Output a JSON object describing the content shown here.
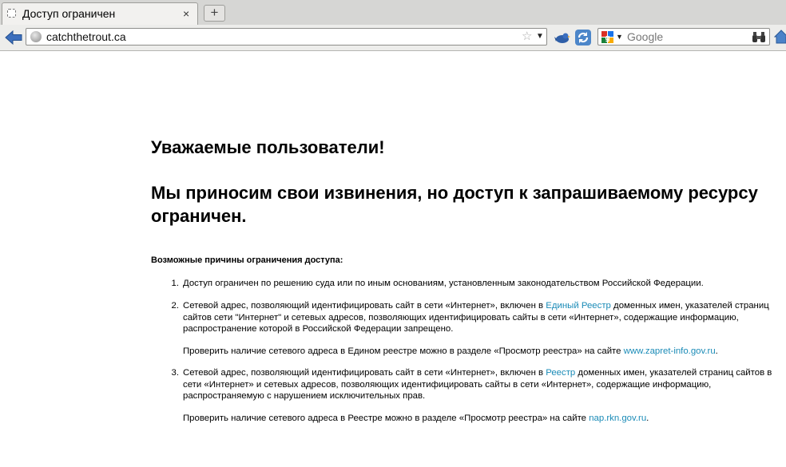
{
  "browser": {
    "tab": {
      "title": "Доступ ограничен",
      "close": "×"
    },
    "new_tab": "+",
    "url": "catchthetrout.ca",
    "search": {
      "engine": "Google",
      "placeholder": "Google"
    }
  },
  "page": {
    "greeting": "Уважаемые пользователи!",
    "apology": "Мы приносим свои извинения, но доступ к запрашиваемому ресурсу ограничен.",
    "reasons_title": "Возможные причины ограничения доступа:",
    "reasons": [
      {
        "num": "1.",
        "text": "Доступ ограничен  по решению суда или по иным основаниям, установленным законодательством Российской Федерации."
      },
      {
        "num": "2.",
        "text_before": "Сетевой адрес, позволяющий идентифицировать сайт в сети «Интернет», включен в ",
        "link": "Единый Реестр",
        "text_after": " доменных имен, указателей страниц сайтов сети \"Интернет\" и сетевых адресов, позволяющих идентифицировать сайты в сети «Интернет», содержащие информацию, распространение которой в Российской Федерации запрещено.",
        "check_before": "Проверить наличие сетевого адреса в Едином реестре можно в разделе «Просмотр реестра» на сайте ",
        "check_link": "www.zapret-info.gov.ru",
        "check_after": "."
      },
      {
        "num": "3.",
        "text_before": "Сетевой адрес, позволяющий идентифицировать сайт в сети «Интернет», включен в ",
        "link": "Реестр",
        "text_after": " доменных имен, указателей страниц сайтов в сети «Интернет» и сетевых адресов, позволяющих идентифицировать сайты в сети «Интернет», содержащие информацию, распространяемую с нарушением исключительных прав.",
        "check_before": "Проверить наличие сетевого адреса в Реестре можно в разделе «Просмотр реестра» на сайте ",
        "check_link": "nap.rkn.gov.ru",
        "check_after": "."
      }
    ]
  },
  "colors": {
    "link": "#1a8bb7",
    "chrome": "#ededeb"
  }
}
